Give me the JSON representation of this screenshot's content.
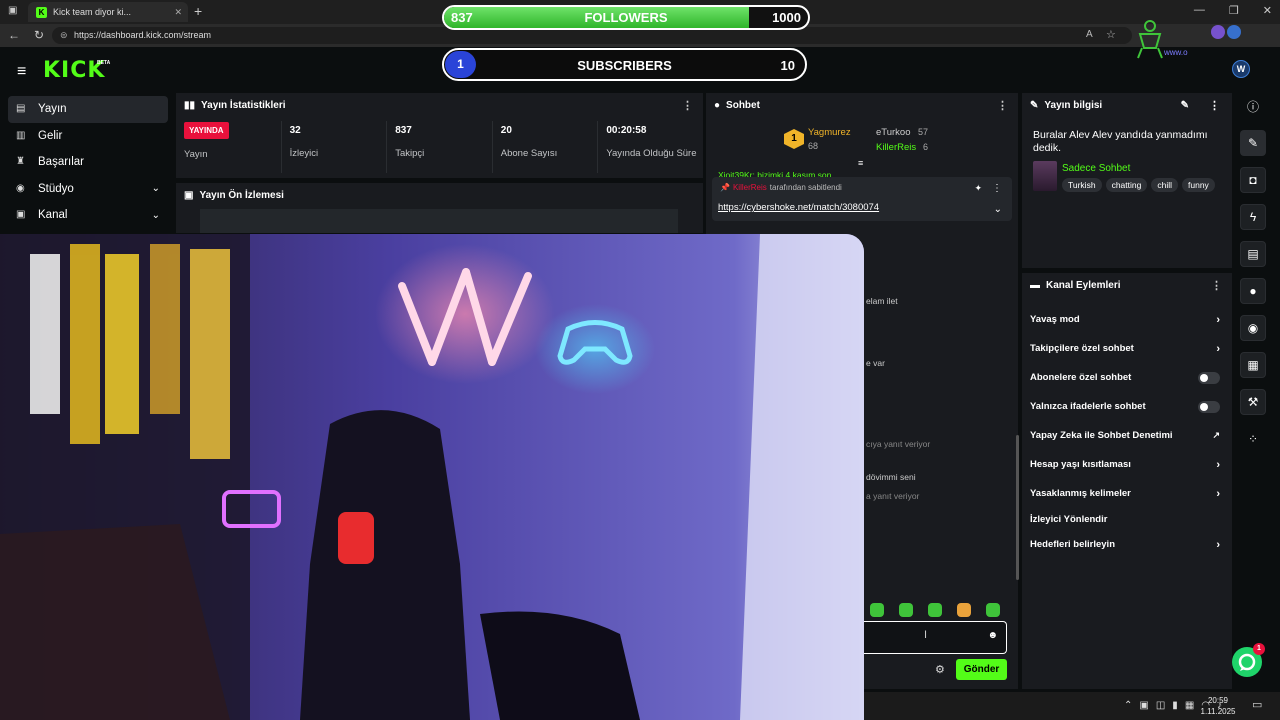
{
  "browser": {
    "tab_title": "Kick team diyor ki...",
    "tab_favicon": "K",
    "new_tab": "+",
    "close_tab": "✕",
    "url": "https://dashboard.kick.com/stream",
    "window_controls": [
      "—",
      "❐",
      "✕"
    ]
  },
  "overlay": {
    "followers_current": "837",
    "followers_label": "FOLLOWERS",
    "followers_target": "1000",
    "followers_progress": 0.837,
    "subs_current": "1",
    "subs_label": "SUBSCRIBERS",
    "subs_target": "10",
    "brand_sub": "www.o"
  },
  "header": {
    "logo": "KICK",
    "beta": "BETA",
    "avatar_letter": "W"
  },
  "sidebar": {
    "items": [
      {
        "label": "Yayın",
        "icon": "broadcast-icon"
      },
      {
        "label": "Gelir",
        "icon": "revenue-icon"
      },
      {
        "label": "Başarılar",
        "icon": "trophy-icon"
      },
      {
        "label": "Stüdyo",
        "icon": "studio-icon"
      },
      {
        "label": "Kanal",
        "icon": "channel-icon"
      }
    ]
  },
  "stats": {
    "title": "Yayın İstatistikleri",
    "live_badge": "YAYINDA",
    "items": [
      {
        "value": "",
        "label": "Yayın"
      },
      {
        "value": "32",
        "label": "İzleyici"
      },
      {
        "value": "837",
        "label": "Takipçi"
      },
      {
        "value": "20",
        "label": "Abone Sayısı"
      },
      {
        "value": "00:20:58",
        "label": "Yayında Olduğu Süre"
      }
    ]
  },
  "preview": {
    "title": "Yayın Ön İzlemesi"
  },
  "chat": {
    "title": "Sohbet",
    "top_users": [
      {
        "rank": "1",
        "name": "Yagmurez",
        "count": "68"
      },
      {
        "name": "eTurkoo",
        "count": "57"
      },
      {
        "name": "KillerReis",
        "count": "6"
      }
    ],
    "clipped_line": "Xjoit39Kr: bizimki 4 kasım son",
    "pinned_by": "KillerReis",
    "pinned_suffix": "tarafından sabitlendi",
    "pinned_link": "https://cybershoke.net/match/3080074",
    "fragments": [
      "elam ilet",
      "e var",
      "cıya yanıt veriyor",
      "dövimmi seni",
      "a yanıt veriyor"
    ],
    "send_label": "Gönder"
  },
  "info": {
    "title": "Yayın bilgisi",
    "text": "Buralar Alev Alev yandıda yanmadımı dedik.",
    "category": "Sadece Sohbet",
    "tags": [
      "Turkish",
      "chatting",
      "chill",
      "funny"
    ]
  },
  "actions": {
    "title": "Kanal Eylemleri",
    "items": [
      {
        "label": "Yavaş mod",
        "kind": "chevron"
      },
      {
        "label": "Takipçilere özel sohbet",
        "kind": "chevron"
      },
      {
        "label": "Abonelere özel sohbet",
        "kind": "toggle",
        "on": false
      },
      {
        "label": "Yalnızca ifadelerle sohbet",
        "kind": "toggle",
        "on": false
      },
      {
        "label": "Yapay Zeka ile Sohbet Denetimi",
        "kind": "external"
      },
      {
        "label": "Hesap yaşı kısıtlaması",
        "kind": "chevron"
      },
      {
        "label": "Yasaklanmış kelimeler",
        "kind": "chevron"
      },
      {
        "label": "İzleyici Yönlendir",
        "kind": "none"
      },
      {
        "label": "Hedefleri belirleyin",
        "kind": "chevron"
      }
    ]
  },
  "support_badge": "1",
  "taskbar": {
    "time": "20:59",
    "date": "1.11.2025"
  },
  "colors": {
    "accent": "#53fc18",
    "live": "#e9113c",
    "panel": "#191b1f",
    "subs_badge": "#2a44d8"
  }
}
